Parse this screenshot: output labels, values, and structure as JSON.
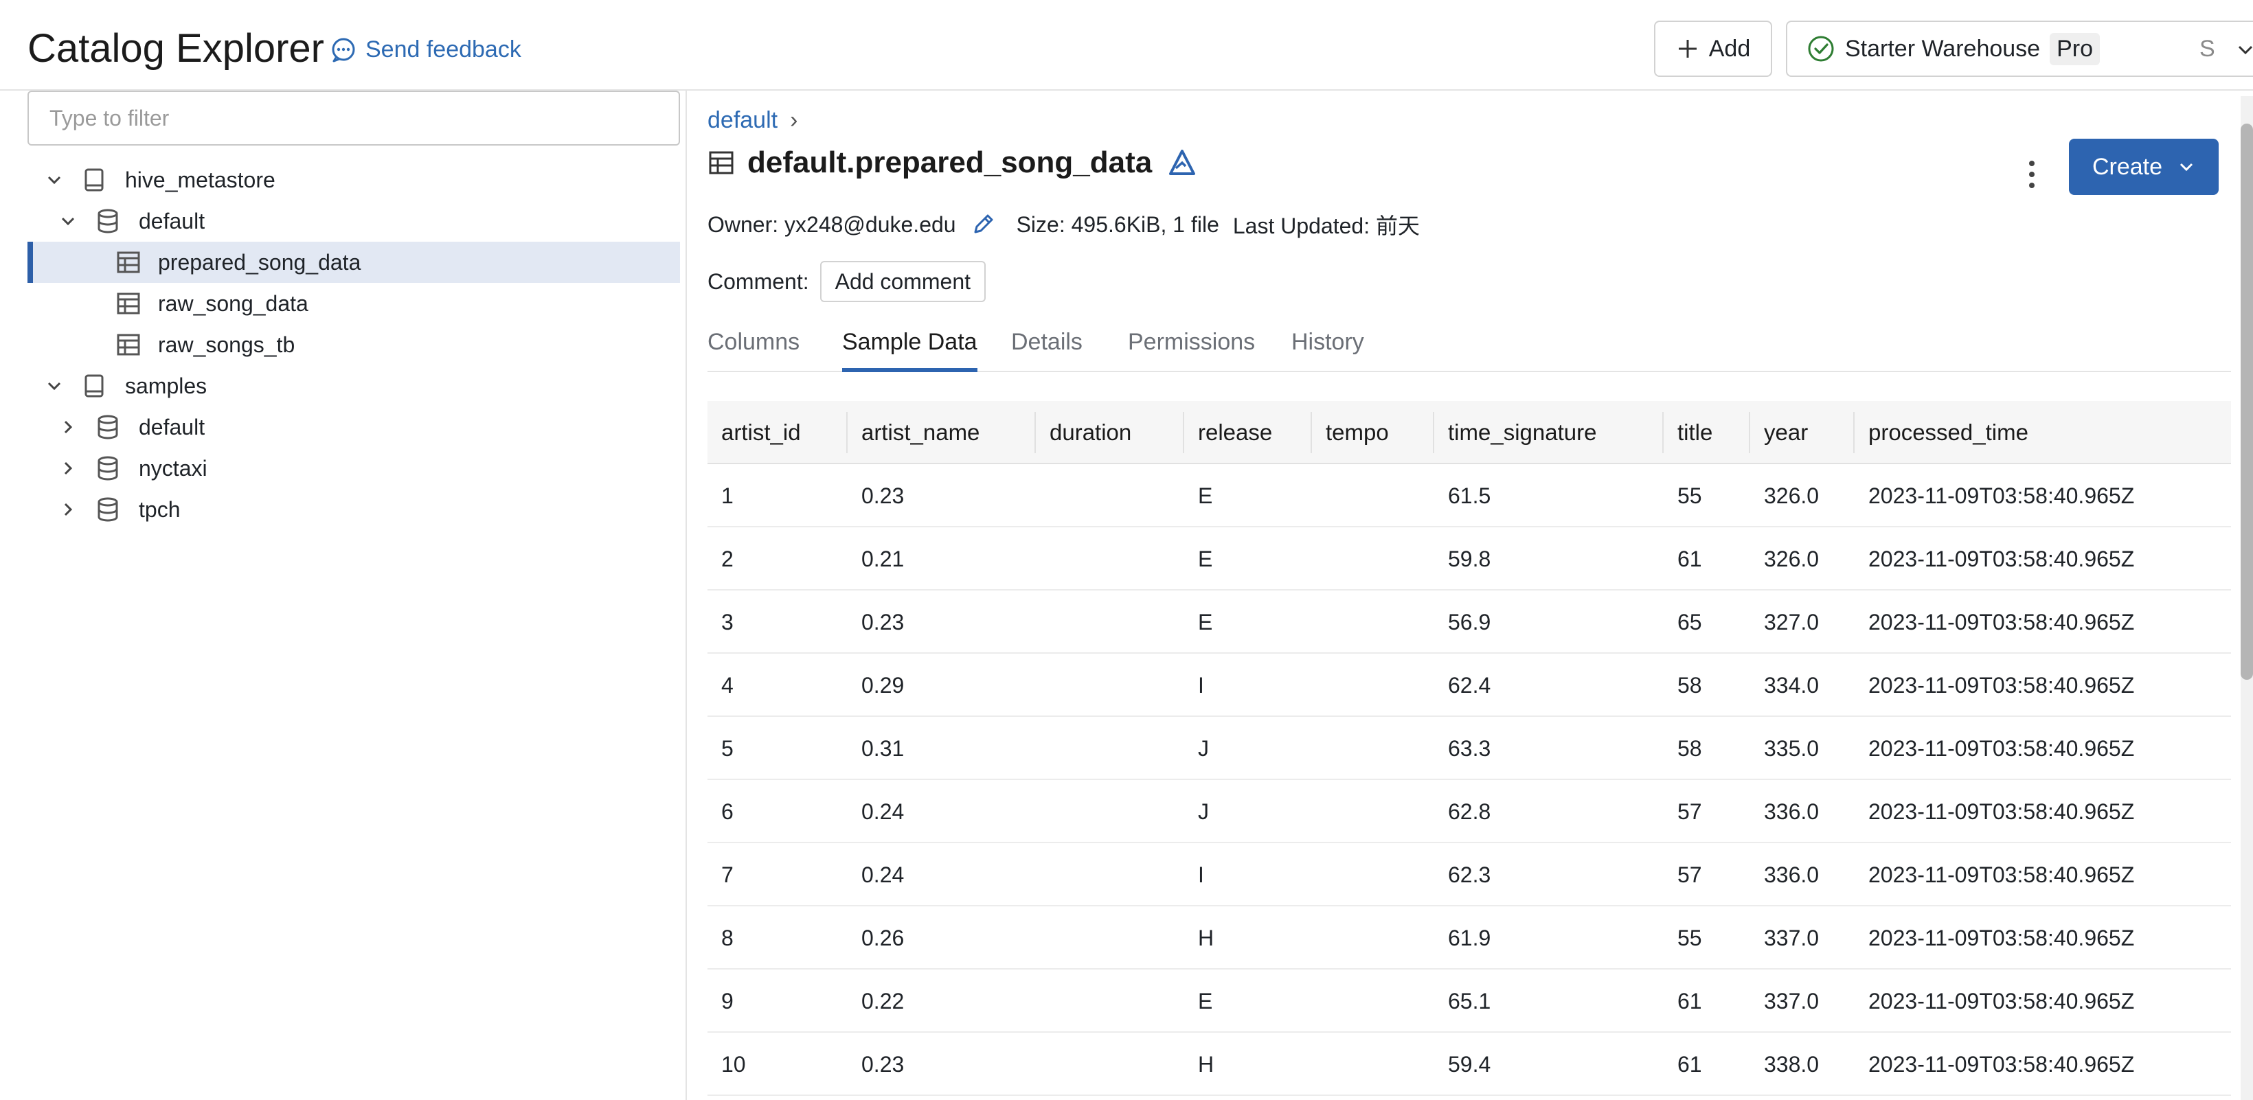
{
  "header": {
    "title": "Catalog Explorer",
    "feedback_label": "Send feedback",
    "add_label": "Add",
    "warehouse": {
      "name": "Starter Warehouse",
      "badge": "Pro",
      "size": "S"
    }
  },
  "sidebar": {
    "filter_placeholder": "Type to filter",
    "tree": [
      {
        "label": "hive_metastore",
        "type": "catalog",
        "expanded": true
      },
      {
        "label": "default",
        "type": "schema",
        "expanded": true
      },
      {
        "label": "prepared_song_data",
        "type": "table",
        "selected": true
      },
      {
        "label": "raw_song_data",
        "type": "table"
      },
      {
        "label": "raw_songs_tb",
        "type": "table"
      },
      {
        "label": "samples",
        "type": "catalog",
        "expanded": true
      },
      {
        "label": "default",
        "type": "schema",
        "expanded": false
      },
      {
        "label": "nyctaxi",
        "type": "schema",
        "expanded": false
      },
      {
        "label": "tpch",
        "type": "schema",
        "expanded": false
      }
    ]
  },
  "main": {
    "breadcrumb": "default",
    "breadcrumb_sep": "›",
    "table_name": "default.prepared_song_data",
    "create_label": "Create",
    "owner": "Owner: yx248@duke.edu",
    "size": "Size: 495.6KiB, 1 file",
    "updated": "Last Updated: 前天",
    "comment_label": "Comment:",
    "add_comment_label": "Add comment",
    "tabs": [
      "Columns",
      "Sample Data",
      "Details",
      "Permissions",
      "History"
    ],
    "active_tab": "Sample Data"
  },
  "table": {
    "columns": [
      "artist_id",
      "artist_name",
      "duration",
      "release",
      "tempo",
      "time_signature",
      "title",
      "year",
      "processed_time"
    ],
    "rows": [
      [
        "1",
        "0.23",
        "",
        "E",
        "",
        "61.5",
        "55",
        "326.0",
        "2023-11-09T03:58:40.965Z"
      ],
      [
        "2",
        "0.21",
        "",
        "E",
        "",
        "59.8",
        "61",
        "326.0",
        "2023-11-09T03:58:40.965Z"
      ],
      [
        "3",
        "0.23",
        "",
        "E",
        "",
        "56.9",
        "65",
        "327.0",
        "2023-11-09T03:58:40.965Z"
      ],
      [
        "4",
        "0.29",
        "",
        "I",
        "",
        "62.4",
        "58",
        "334.0",
        "2023-11-09T03:58:40.965Z"
      ],
      [
        "5",
        "0.31",
        "",
        "J",
        "",
        "63.3",
        "58",
        "335.0",
        "2023-11-09T03:58:40.965Z"
      ],
      [
        "6",
        "0.24",
        "",
        "J",
        "",
        "62.8",
        "57",
        "336.0",
        "2023-11-09T03:58:40.965Z"
      ],
      [
        "7",
        "0.24",
        "",
        "I",
        "",
        "62.3",
        "57",
        "336.0",
        "2023-11-09T03:58:40.965Z"
      ],
      [
        "8",
        "0.26",
        "",
        "H",
        "",
        "61.9",
        "55",
        "337.0",
        "2023-11-09T03:58:40.965Z"
      ],
      [
        "9",
        "0.22",
        "",
        "E",
        "",
        "65.1",
        "61",
        "337.0",
        "2023-11-09T03:58:40.965Z"
      ],
      [
        "10",
        "0.23",
        "",
        "H",
        "",
        "59.4",
        "61",
        "338.0",
        "2023-11-09T03:58:40.965Z"
      ]
    ]
  },
  "colors": {
    "accent": "#2d64b0",
    "link": "#2d6ab3",
    "selected_row": "#e2e8f3",
    "success": "#2e7d32"
  },
  "icons": {
    "feedback": "chat-bubble-icon",
    "add": "plus-icon",
    "warehouse_status": "check-circle-icon",
    "catalog": "book-icon",
    "schema": "database-icon",
    "table": "table-icon",
    "delta": "delta-icon",
    "edit": "pencil-icon",
    "more": "kebab-menu-icon"
  }
}
